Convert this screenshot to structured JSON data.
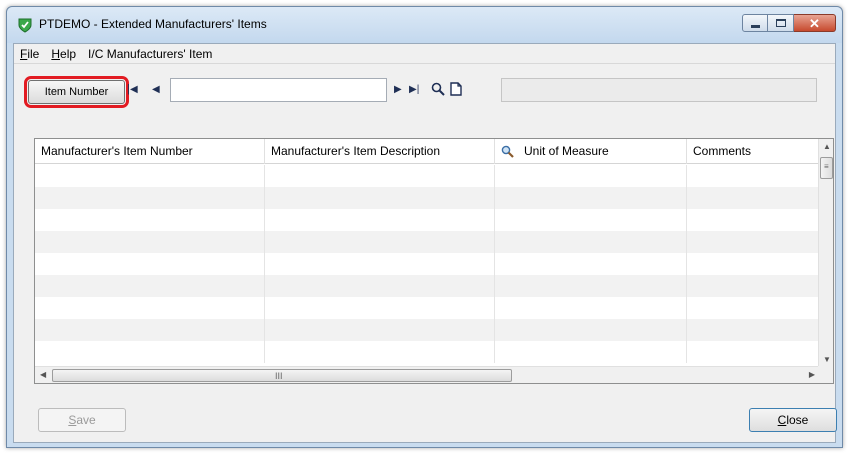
{
  "window": {
    "title": "PTDEMO - Extended Manufacturers' Items"
  },
  "menu": [
    {
      "accel": "F",
      "rest": "ile"
    },
    {
      "accel": "H",
      "rest": "elp"
    },
    {
      "accel": "",
      "rest": "I/C Manufacturers' Item"
    }
  ],
  "toolbar": {
    "item_number_label": "Item Number",
    "finder_value": "",
    "description_value": ""
  },
  "grid": {
    "columns": [
      "Manufacturer's Item Number",
      "Manufacturer's Item Description",
      "Unit of Measure",
      "Comments"
    ],
    "rows": [],
    "scroll_grip": "III"
  },
  "buttons": {
    "save": {
      "accel": "S",
      "rest": "ave"
    },
    "close": {
      "accel": "C",
      "rest": "lose"
    }
  },
  "colors": {
    "highlight": "#e21b22",
    "app_icon": "#3aa84a"
  }
}
